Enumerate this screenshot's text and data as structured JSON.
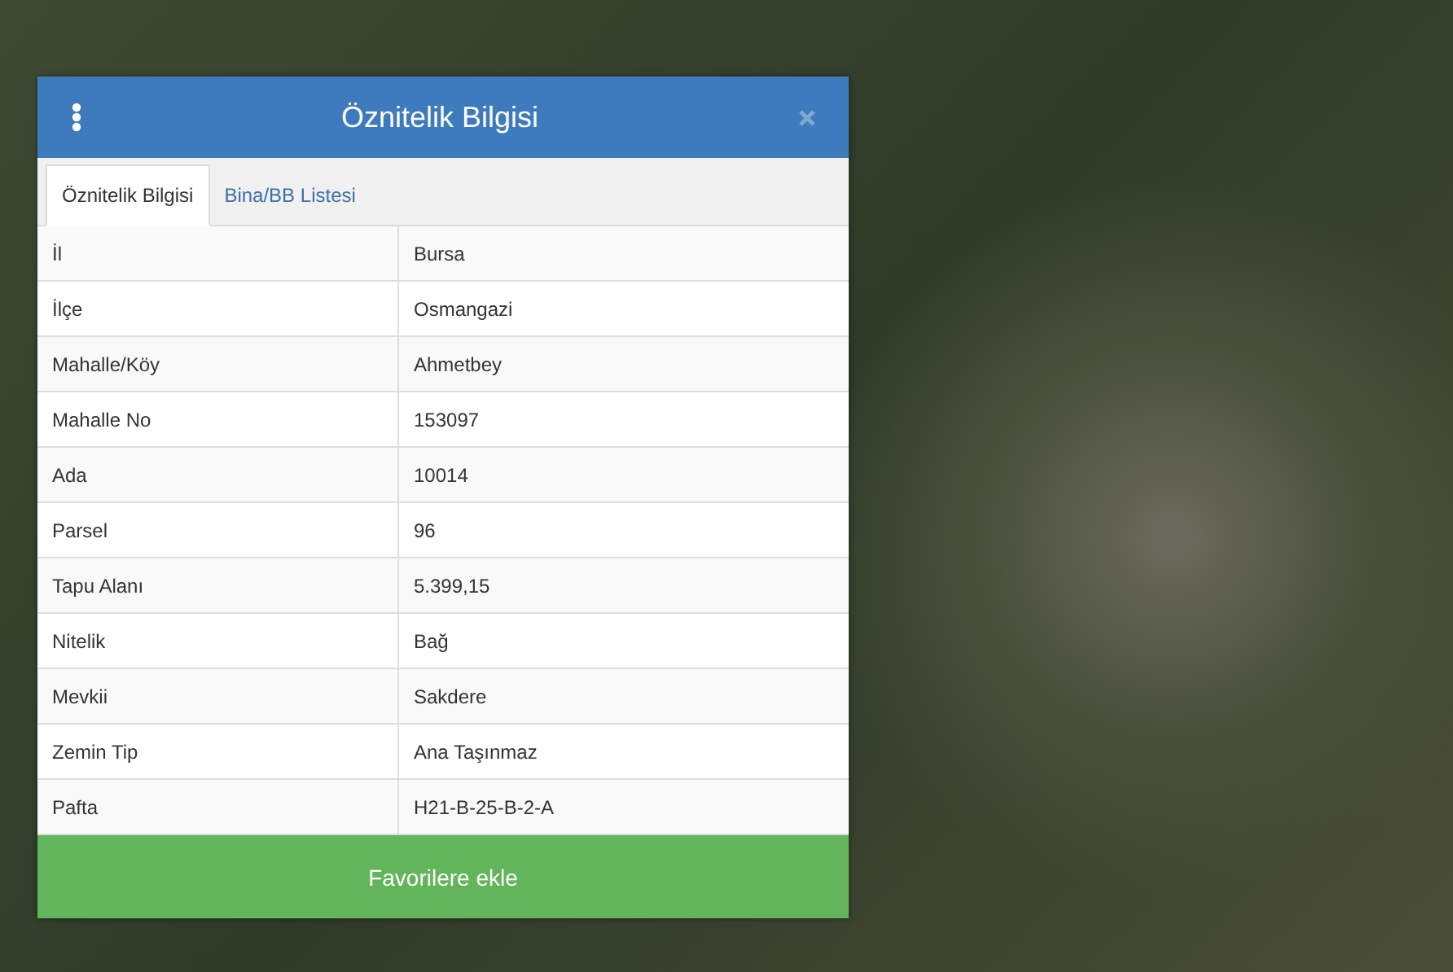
{
  "panel": {
    "title": "Öznitelik Bilgisi"
  },
  "tabs": [
    {
      "label": "Öznitelik Bilgisi",
      "selected": true
    },
    {
      "label": "Bina/BB Listesi",
      "selected": false
    }
  ],
  "table": {
    "rows": [
      {
        "label": "İl",
        "value": "Bursa"
      },
      {
        "label": "İlçe",
        "value": "Osmangazi"
      },
      {
        "label": "Mahalle/Köy",
        "value": "Ahmetbey"
      },
      {
        "label": "Mahalle No",
        "value": "153097"
      },
      {
        "label": "Ada",
        "value": "10014"
      },
      {
        "label": "Parsel",
        "value": "96"
      },
      {
        "label": "Tapu Alanı",
        "value": "5.399,15"
      },
      {
        "label": "Nitelik",
        "value": "Bağ"
      },
      {
        "label": "Mevkii",
        "value": "Sakdere"
      },
      {
        "label": "Zemin Tip",
        "value": "Ana Taşınmaz"
      },
      {
        "label": "Pafta",
        "value": "H21-B-25-B-2-A"
      }
    ]
  },
  "button": {
    "label": "Favorilere ekle"
  }
}
